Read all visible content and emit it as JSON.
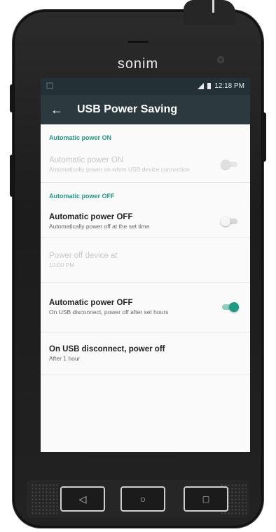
{
  "device": {
    "brand": "sonim"
  },
  "status_bar": {
    "time": "12:18 PM"
  },
  "app_bar": {
    "title": "USB Power Saving",
    "back_icon": "arrow-left-icon"
  },
  "sections": [
    {
      "header": "Automatic power ON",
      "items": [
        {
          "title": "Automatic power ON",
          "summary": "Automatically power on when USB device connection",
          "enabled": false,
          "toggle": "off"
        }
      ]
    },
    {
      "header": "Automatic power OFF",
      "items": [
        {
          "title": "Automatic power OFF",
          "summary": "Automatically power off at the set time",
          "enabled": true,
          "toggle": "off"
        },
        {
          "title": "Power off device at",
          "summary": "10:00 PM",
          "enabled": false
        },
        {
          "title": "Automatic power OFF",
          "summary": "On USB disconnect, power off after set hours",
          "enabled": true,
          "toggle": "on"
        },
        {
          "title": "On USB disconnect, power off",
          "summary": "After 1 hour",
          "enabled": true
        }
      ]
    }
  ],
  "nav_buttons": {
    "back": "◁",
    "home": "○",
    "recents": "□"
  },
  "colors": {
    "accent": "#1e9b85",
    "appbar": "#2c3a3f",
    "statusbar": "#233035"
  }
}
